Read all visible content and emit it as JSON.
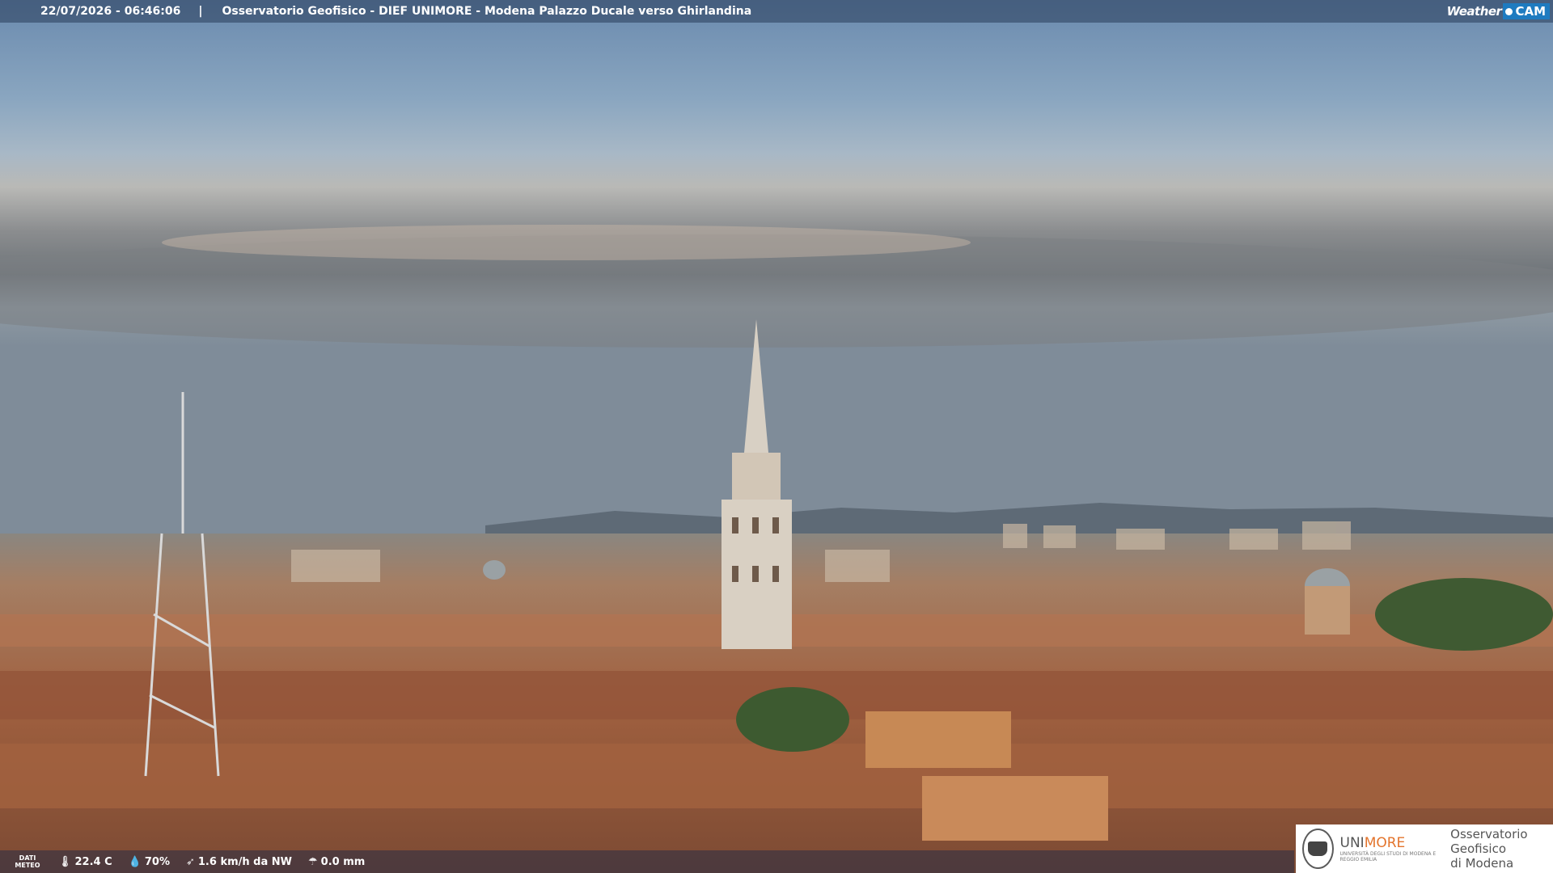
{
  "header": {
    "datetime": "22/07/2026 - 06:46:06",
    "separator": "|",
    "title": "Osservatorio Geofisico - DIEF UNIMORE - Modena Palazzo Ducale verso Ghirlandina",
    "brand_weather": "Weather",
    "brand_cam": "CAM"
  },
  "weather": {
    "label": "DATI METEO",
    "temperature": "22.4 C",
    "humidity": "70%",
    "wind": "1.6 km/h da NW",
    "rain": "0.0 mm"
  },
  "logo": {
    "unimore_prefix": "UNI",
    "unimore_suffix": "MORE",
    "unimore_sub": "UNIVERSITÀ DEGLI STUDI DI MODENA E REGGIO EMILIA",
    "observatory_line1": "Osservatorio Geofisico",
    "observatory_line2": "di Modena"
  },
  "icons": [
    "thermometer-icon",
    "humidity-drop-icon",
    "wind-icon",
    "rain-icon",
    "unimore-seal-icon",
    "weathercam-dot-icon"
  ],
  "colors": {
    "sky_top": "#6e8db0",
    "clouds": "#7a7e80",
    "roofs": "#a2603f",
    "tower": "#d8cfc2",
    "brand_blue": "#1e7bc0",
    "unimore_orange": "#e3742c"
  }
}
